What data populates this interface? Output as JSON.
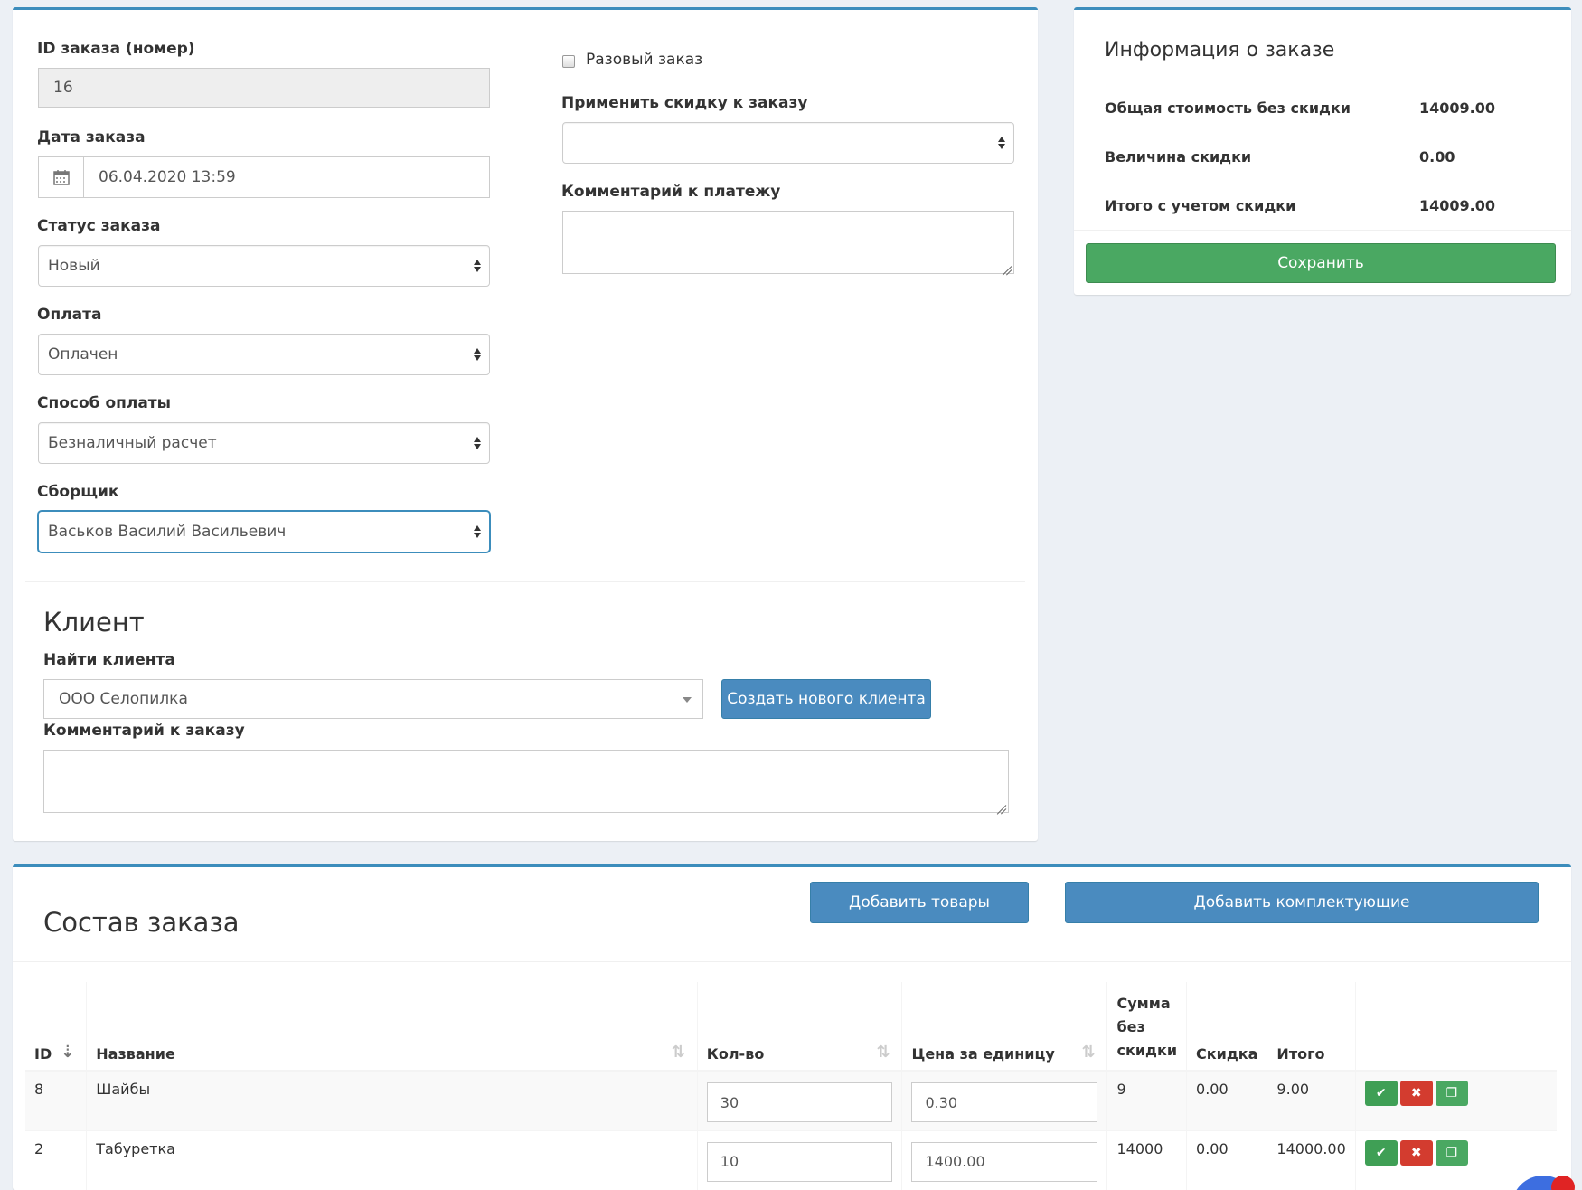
{
  "order_form": {
    "id_label": "ID заказа (номер)",
    "id_value": "16",
    "date_label": "Дата заказа",
    "date_value": "06.04.2020 13:59",
    "status_label": "Статус заказа",
    "status_value": "Новый",
    "payment_label": "Оплата",
    "payment_value": "Оплачен",
    "payment_method_label": "Способ оплаты",
    "payment_method_value": "Безналичный расчет",
    "assembler_label": "Сборщик",
    "assembler_value": "Васьков Василий Васильевич",
    "one_time_label": "Разовый заказ",
    "discount_label": "Применить скидку к заказу",
    "discount_value": "",
    "payment_comment_label": "Комментарий к платежу"
  },
  "client": {
    "title": "Клиент",
    "find_label": "Найти клиента",
    "find_value": "ООО Селопилка",
    "create_button": "Создать нового клиента",
    "order_comment_label": "Комментарий к заказу"
  },
  "info": {
    "title": "Информация о заказе",
    "rows": [
      {
        "label": "Общая стоимость без скидки",
        "value": "14009.00"
      },
      {
        "label": "Величина скидки",
        "value": "0.00"
      },
      {
        "label": "Итого с учетом скидки",
        "value": "14009.00"
      }
    ],
    "save_button": "Сохранить"
  },
  "composition": {
    "title": "Состав заказа",
    "add_goods_button": "Добавить товары",
    "add_parts_button": "Добавить комплектующие",
    "headers": {
      "id": "ID",
      "name": "Название",
      "qty": "Кол-во",
      "price": "Цена за единицу",
      "sum_line1": "Сумма",
      "sum_line2": "без",
      "sum_line3": "скидки",
      "discount": "Скидка",
      "total": "Итого"
    },
    "rows": [
      {
        "id": "8",
        "name": "Шайбы",
        "qty": "30",
        "price": "0.30",
        "sum": "9",
        "discount": "0.00",
        "total": "9.00"
      },
      {
        "id": "2",
        "name": "Табуретка",
        "qty": "10",
        "price": "1400.00",
        "sum": "14000",
        "discount": "0.00",
        "total": "14000.00"
      }
    ]
  },
  "colors": {
    "accent": "#3c8dbc",
    "button_blue": "#4a8bbf",
    "button_green": "#4aa862",
    "button_red": "#d33c2f"
  }
}
